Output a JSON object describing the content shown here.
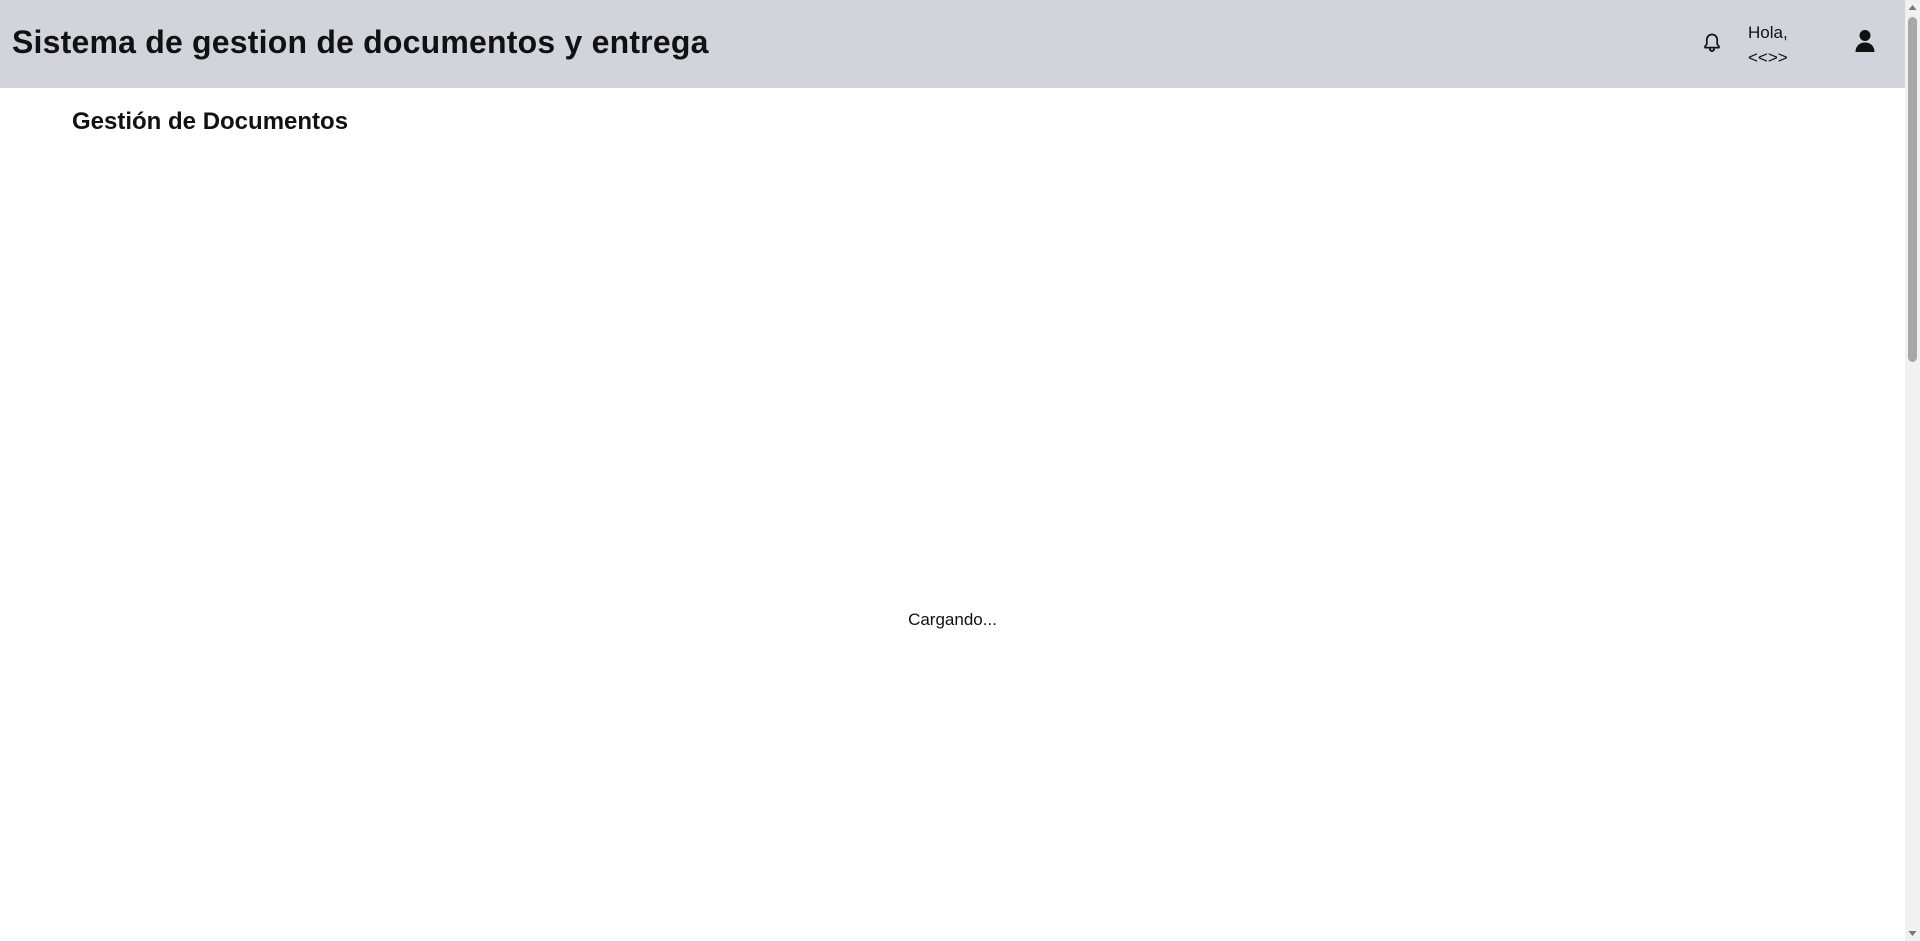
{
  "header": {
    "title": "Sistema de gestion de documentos y entrega",
    "greeting_line1": "Hola,",
    "greeting_line2": "<<>>",
    "notification_icon": "bell-icon",
    "user_icon": "user-icon",
    "background_color": "#d1d5db"
  },
  "main": {
    "heading": "Gestión de Documentos",
    "loading_text": "Cargando..."
  }
}
